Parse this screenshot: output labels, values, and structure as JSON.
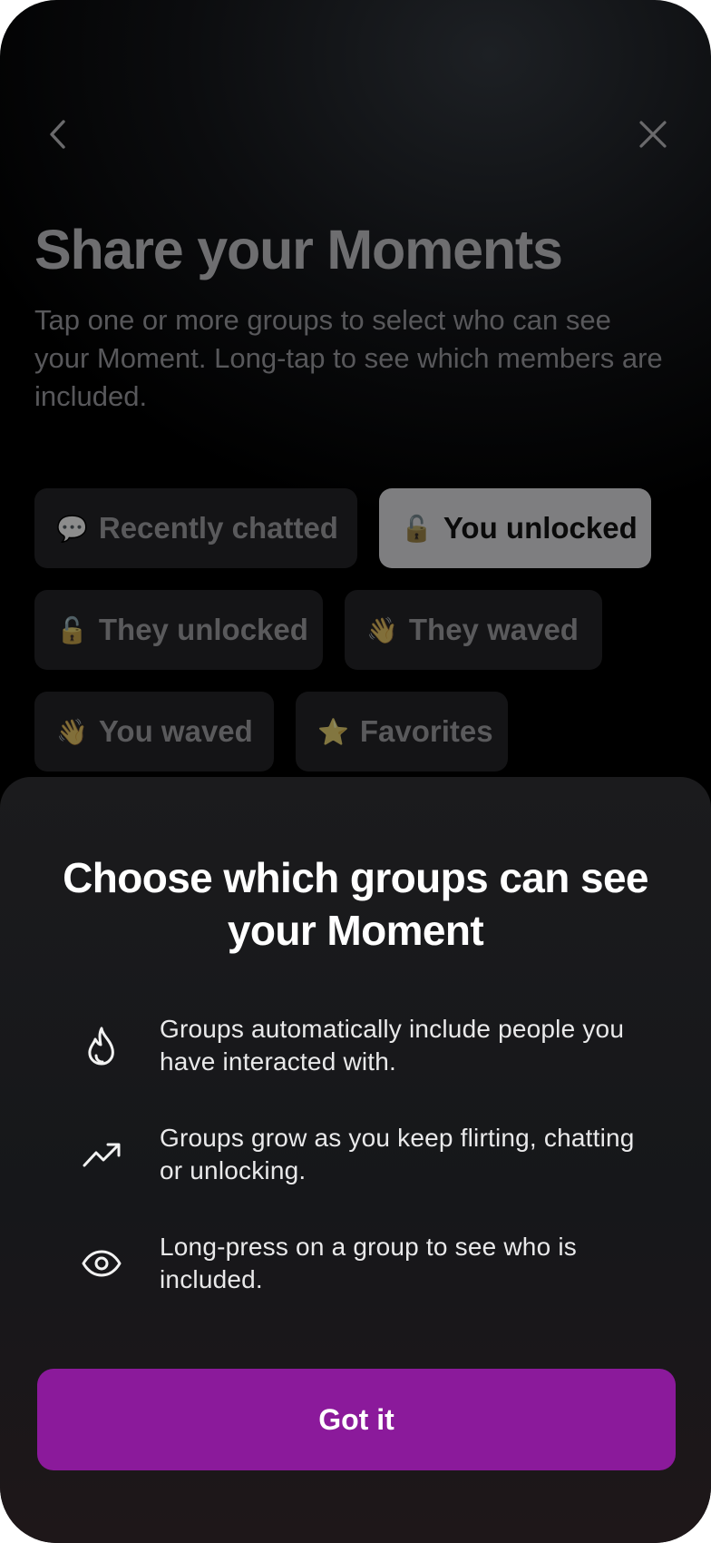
{
  "header": {
    "back_icon": "chevron-left-icon",
    "close_icon": "close-icon",
    "title": "Share your Moments",
    "subtitle": "Tap one or more groups to select who can see your Moment. Long-tap to see which members are included."
  },
  "groups": [
    {
      "emoji": "💬",
      "label": "Recently chatted",
      "selected": false
    },
    {
      "emoji": "🔓",
      "label": "You unlocked",
      "selected": true
    },
    {
      "emoji": "🔓",
      "label": "They unlocked",
      "selected": false
    },
    {
      "emoji": "👋",
      "label": "They waved",
      "selected": false
    },
    {
      "emoji": "👋",
      "label": "You waved",
      "selected": false
    },
    {
      "emoji": "⭐",
      "label": "Favorites",
      "selected": false
    }
  ],
  "sheet": {
    "title": "Choose which groups can see your Moment",
    "tips": [
      {
        "icon": "flame-icon",
        "text": "Groups automatically include people you have interacted with."
      },
      {
        "icon": "trending-up-icon",
        "text": "Groups grow as you keep flirting, chatting or unlocking."
      },
      {
        "icon": "eye-icon",
        "text": "Long-press on a group to see who is included."
      }
    ],
    "button_label": "Got it"
  },
  "colors": {
    "accent": "#8b1a9b",
    "selected_chip": "#7e7e80",
    "chip": "#141416",
    "sheet": "#1b1b1d"
  }
}
